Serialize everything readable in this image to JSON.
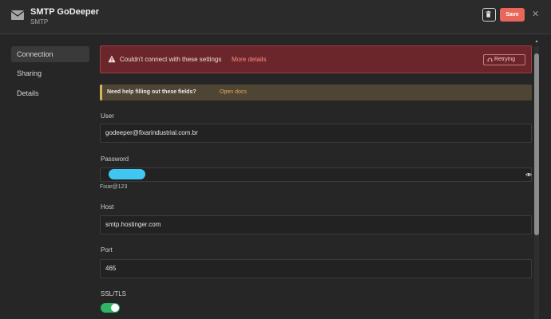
{
  "header": {
    "icon": "mail-icon",
    "title": "SMTP GoDeeper",
    "subtitle": "SMTP",
    "delete_icon": "trash-icon",
    "save_label": "Save",
    "close_icon": "close-icon",
    "close_glyph": "✕"
  },
  "sidebar": {
    "items": [
      {
        "label": "Connection",
        "active": true
      },
      {
        "label": "Sharing",
        "active": false
      },
      {
        "label": "Details",
        "active": false
      }
    ]
  },
  "alert": {
    "icon": "warning-icon",
    "message": "Couldn't connect with these settings",
    "link": "More details",
    "retry_icon": "headset-icon",
    "retry_label": "Retrying",
    "color": "#6b262b"
  },
  "help": {
    "message": "Need help filling out these fields?",
    "link": "Open docs"
  },
  "fields": {
    "user": {
      "label": "User",
      "value": "godeeper@fixarindustrial.com.br"
    },
    "password": {
      "label": "Password",
      "hint": "Fixar@123",
      "reveal_icon": "eye-icon"
    },
    "host": {
      "label": "Host",
      "value": "smtp.hostinger.com"
    },
    "port": {
      "label": "Port",
      "value": "465"
    },
    "ssl": {
      "label": "SSL/TLS",
      "enabled": true
    }
  },
  "colors": {
    "accent": "#e8665a",
    "toggle_on": "#2fb566",
    "background": "#262626"
  }
}
